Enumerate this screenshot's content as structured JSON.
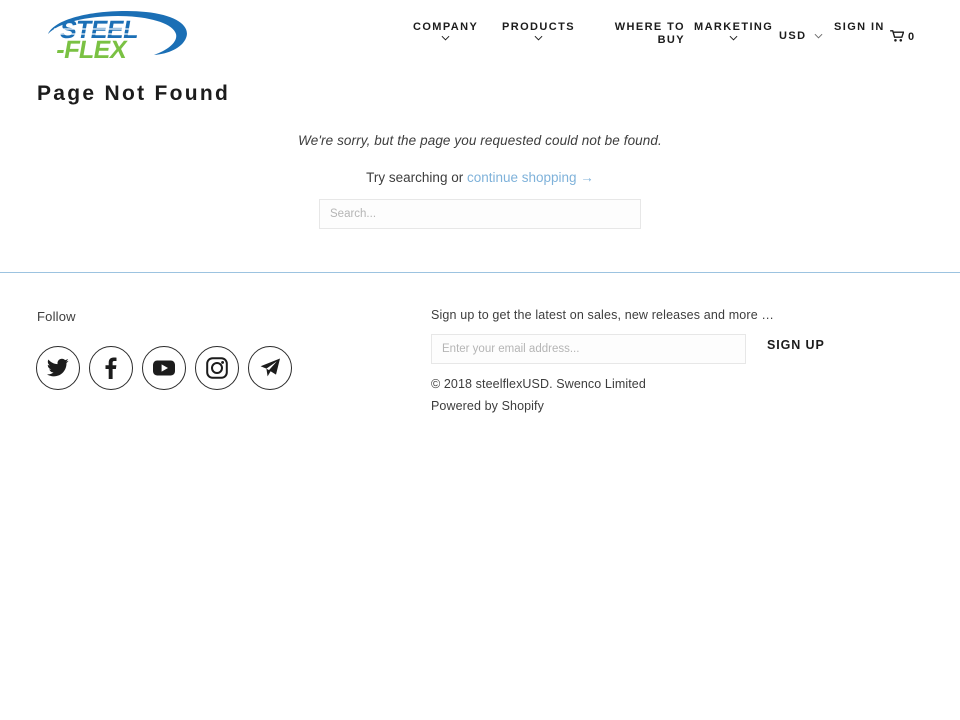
{
  "brand": {
    "logo_text_primary": "STEEL",
    "logo_text_secondary": "FLEX",
    "logo_alt": "steelflexUSD logo",
    "color_blue": "#1b6fb5",
    "color_green": "#7ac143",
    "accent_link": "#7fb2da",
    "divider": "#9cc3e0"
  },
  "nav": {
    "items": [
      {
        "label": "COMPANY",
        "has_dropdown": true,
        "icon": "chevron-down-icon"
      },
      {
        "label": "PRODUCTS",
        "has_dropdown": true,
        "icon": "chevron-down-icon"
      },
      {
        "label": "WHERE TO BUY",
        "has_dropdown": false
      },
      {
        "label": "MARKETING",
        "has_dropdown": true,
        "icon": "chevron-down-icon"
      }
    ],
    "currency": {
      "label": "USD",
      "icon": "chevron-down-icon"
    },
    "sign_in": "SIGN IN",
    "cart": {
      "icon": "shopping-cart-icon",
      "count": "0"
    }
  },
  "main": {
    "title": "Page Not Found",
    "message": "We're sorry, but the page you requested could not be found.",
    "sub_prefix": "Try searching or ",
    "sub_link": "continue shopping →",
    "search": {
      "placeholder": "Search...",
      "value": ""
    }
  },
  "footer": {
    "follow_heading": "Follow",
    "social": [
      {
        "name": "twitter-icon",
        "label": "Twitter"
      },
      {
        "name": "facebook-icon",
        "label": "Facebook"
      },
      {
        "name": "youtube-icon",
        "label": "YouTube"
      },
      {
        "name": "instagram-icon",
        "label": "Instagram"
      },
      {
        "name": "email-icon",
        "label": "Email"
      }
    ],
    "newsletter": {
      "heading": "Sign up to get the latest on sales, new releases and more …",
      "placeholder": "Enter your email address...",
      "value": "",
      "submit_label": "SIGN UP"
    },
    "copyright": "© 2018 steelflexUSD. Swenco Limited",
    "powered_by": "Powered by Shopify"
  }
}
